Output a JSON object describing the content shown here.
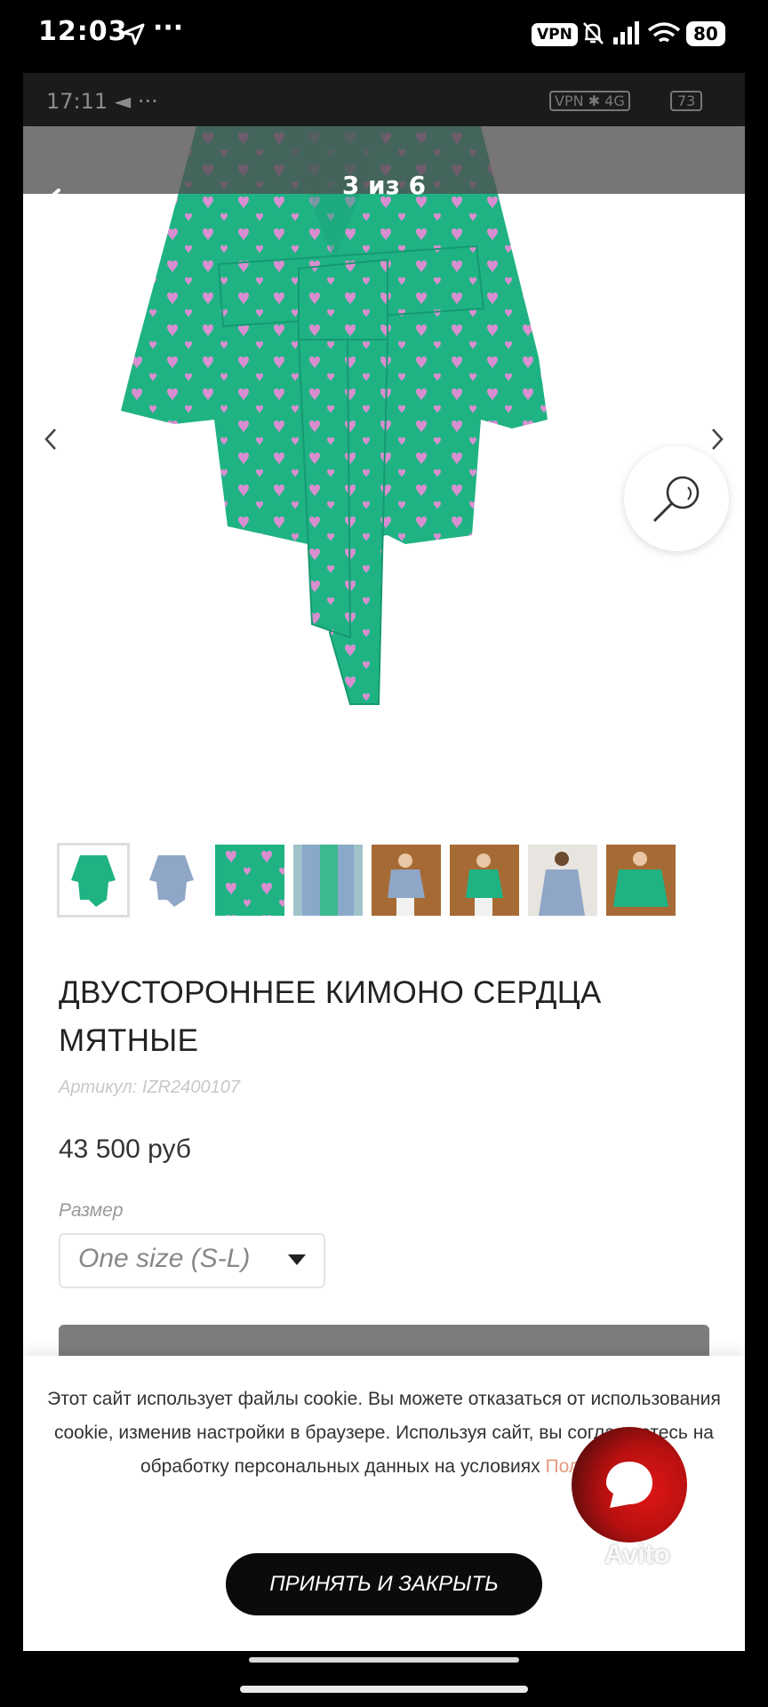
{
  "phone_status": {
    "time": "12:03",
    "dots": "···",
    "vpn": "VPN",
    "battery": "80"
  },
  "recorded_status": {
    "time": "17:11 ◄ ···",
    "network": "VPN ✱ 4G",
    "battery": "73"
  },
  "gallery": {
    "counter": "3 из 6",
    "back_icon": "arrow-left-icon",
    "thumbnail_count": 8
  },
  "product": {
    "title": "ДВУСТОРОННЕЕ КИМОНО СЕРДЦА МЯТНЫЕ",
    "sku": "Артикул: IZR2400107",
    "price": "43 500 руб",
    "size_label": "Размер",
    "size_value": "One size (S-L)",
    "image_colors": {
      "primary": "#1fb384",
      "pattern": "#d98ed0"
    }
  },
  "cookie": {
    "text_before": "Этот сайт использует файлы cookie. Вы можете отказаться от использования cookie, изменив настройки в браузере. Используя сайт, вы соглашаетесь на обработку персональных данных на условиях ",
    "link": "Политики",
    "accept": "ПРИНЯТЬ И ЗАКРЫТЬ"
  },
  "watermark": "Avito"
}
